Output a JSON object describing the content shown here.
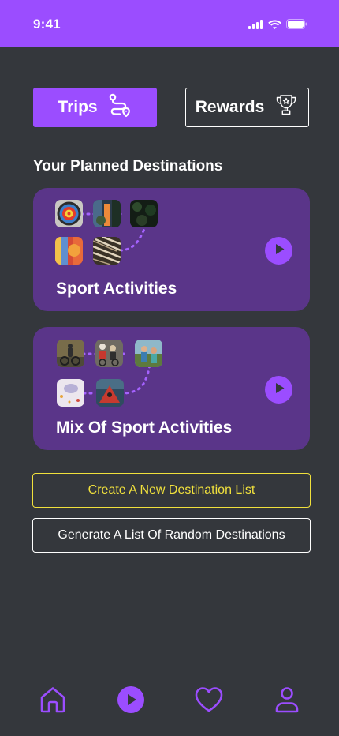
{
  "status_bar": {
    "time": "9:41",
    "icons": [
      "signal-icon",
      "wifi-icon",
      "battery-icon"
    ]
  },
  "tabs": {
    "trips_label": "Trips",
    "trips_icon": "route-icon",
    "rewards_label": "Rewards",
    "rewards_icon": "trophy-icon",
    "active": "Trips"
  },
  "section_title": "Your Planned Destinations",
  "destination_lists": [
    {
      "title": "Sport Activities",
      "thumbnails": [
        "archery-target-photo",
        "sport-blur-photo",
        "dark-forest-photo",
        "colorful-blur-photo",
        "arrows-photo"
      ],
      "action_icon": "play-icon"
    },
    {
      "title": "Mix Of Sport Activities",
      "thumbnails": [
        "cyclist-photo",
        "cycling-group-photo",
        "hikers-photo",
        "bowl-photo",
        "kayak-photo"
      ],
      "action_icon": "play-icon"
    }
  ],
  "actions": {
    "create_label": "Create A New Destination List",
    "generate_label": "Generate A List Of Random Destinations"
  },
  "bottom_nav": [
    "home-icon",
    "play-icon",
    "heart-icon",
    "profile-icon"
  ],
  "colors": {
    "accent": "#9b4dff",
    "background": "#34373c",
    "card": "#5a3589",
    "highlight": "#f0e03c"
  }
}
